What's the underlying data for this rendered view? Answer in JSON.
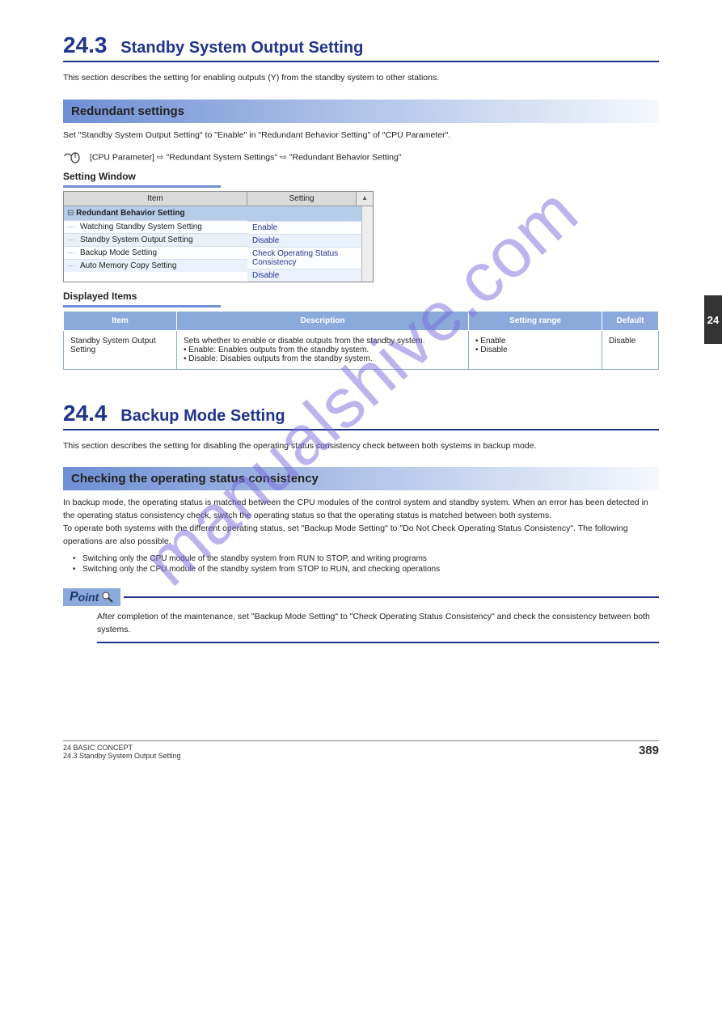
{
  "page_number_top": "24",
  "section": {
    "number": "24.3",
    "title": "Standby System Output Setting"
  },
  "intro_para": "This section describes the setting for enabling outputs (Y) from the standby system to other stations.",
  "redundant_settings_heading": "Redundant settings",
  "redundant_settings_text": "Set \"Standby System Output Setting\" to \"Enable\" in \"Redundant Behavior Setting\" of \"CPU Parameter\".",
  "nav_path": "[CPU Parameter]  \"Redundant System Settings\"  \"Redundant Behavior Setting\"",
  "setting_window_label": "Setting Window",
  "screenshot": {
    "col_item": "Item",
    "col_setting": "Setting",
    "group": "Redundant Behavior Setting",
    "rows": [
      {
        "label": "Watching Standby System Setting",
        "value": "Enable"
      },
      {
        "label": "Standby System Output Setting",
        "value": "Disable"
      },
      {
        "label": "Backup Mode Setting",
        "value": "Check Operating Status Consistency"
      },
      {
        "label": "Auto Memory Copy Setting",
        "value": "Disable"
      }
    ]
  },
  "displayed_items_label": "Displayed Items",
  "di_table": {
    "headers": {
      "item": "Item",
      "desc": "Description",
      "range": "Setting range",
      "default": "Default"
    },
    "row": {
      "item": "Standby System Output Setting",
      "desc": "Sets whether to enable or disable outputs from the standby system.\n• Enable: Enables outputs from the standby system.\n• Disable: Disables outputs from the standby system.",
      "range": "• Enable\n• Disable",
      "default": "Disable"
    }
  },
  "section2": {
    "number": "24.4",
    "title": "Backup Mode Setting"
  },
  "section2_text": "This section describes the setting for disabling the operating status consistency check between both systems in backup mode.",
  "consistency_heading": "Checking the operating status consistency",
  "consistency_text": "In backup mode, the operating status is matched between the CPU modules of the control system and standby system. When an error has been detected in the operating status consistency check, switch the operating status so that the operating status is matched between both systems.\nTo operate both systems with the different operating status, set \"Backup Mode Setting\" to \"Do Not Check Operating Status Consistency\". The following operations are also possible.",
  "consistency_bullets": [
    "Switching only the CPU module of the standby system from RUN to STOP, and writing programs",
    "Switching only the CPU module of the standby system from STOP to RUN, and checking operations"
  ],
  "point_label": "Point",
  "point_text": "After completion of the maintenance, set \"Backup Mode Setting\" to \"Check Operating Status Consistency\" and check the consistency between both systems.",
  "footer": {
    "left": "24 BASIC CONCEPT\n24.3 Standby System Output Setting",
    "right": "389"
  },
  "side_tab": "24"
}
